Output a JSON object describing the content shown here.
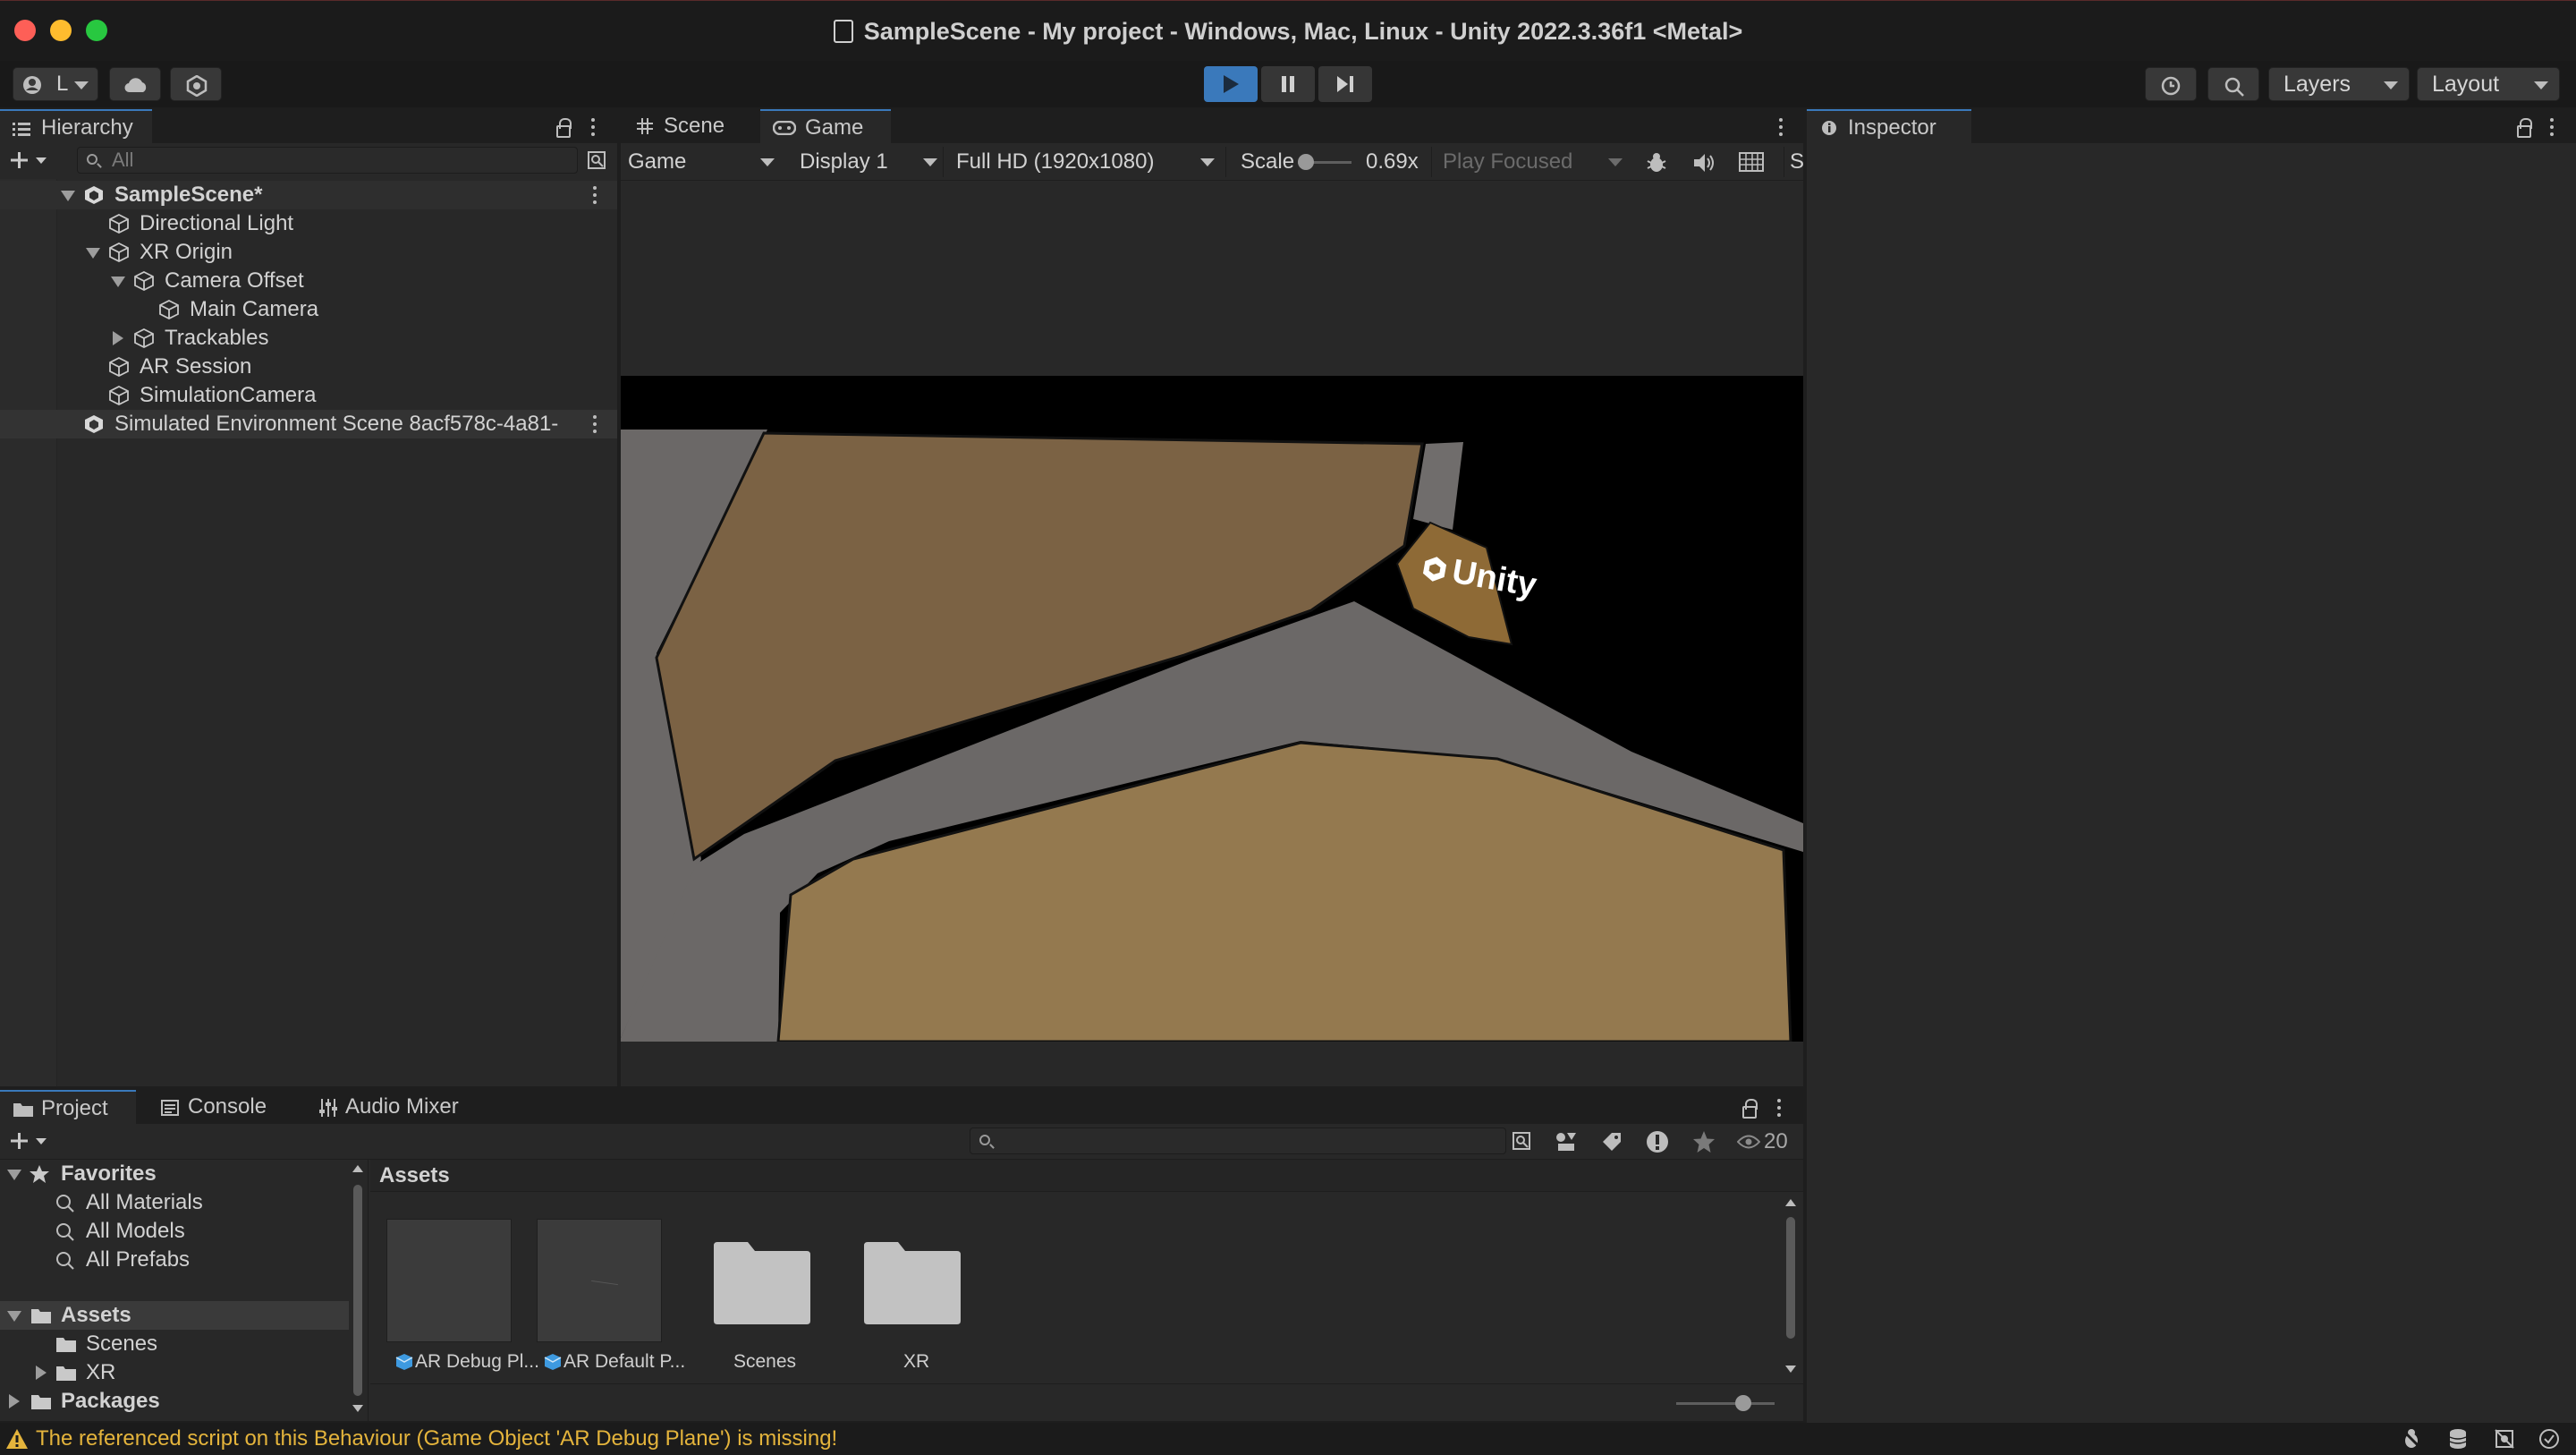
{
  "window": {
    "title": "SampleScene - My project - Windows, Mac, Linux - Unity 2022.3.36f1 <Metal>"
  },
  "toolbar": {
    "account_label": "L",
    "layers_label": "Layers",
    "layout_label": "Layout"
  },
  "hierarchy": {
    "tab_label": "Hierarchy",
    "search_placeholder": "All",
    "items": [
      {
        "label": "SampleScene*"
      },
      {
        "label": "Directional Light"
      },
      {
        "label": "XR Origin"
      },
      {
        "label": "Camera Offset"
      },
      {
        "label": "Main Camera"
      },
      {
        "label": "Trackables"
      },
      {
        "label": "AR Session"
      },
      {
        "label": "SimulationCamera"
      },
      {
        "label": "Simulated Environment Scene 8acf578c-4a81-"
      }
    ]
  },
  "center": {
    "tabs": [
      {
        "label": "Scene"
      },
      {
        "label": "Game"
      }
    ],
    "game_toolbar": {
      "mode": "Game",
      "display": "Display 1",
      "resolution": "Full HD (1920x1080)",
      "scale_label": "Scale",
      "scale_value": "0.69x",
      "play_focused": "Play Focused",
      "trailing": "S"
    },
    "viewport_logo": "Unity"
  },
  "inspector": {
    "tab_label": "Inspector"
  },
  "bottom": {
    "tabs": [
      {
        "label": "Project"
      },
      {
        "label": "Console"
      },
      {
        "label": "Audio Mixer"
      }
    ],
    "hidden_count": "20",
    "tree": {
      "favorites": "Favorites",
      "fav_items": [
        "All Materials",
        "All Models",
        "All Prefabs"
      ],
      "assets": "Assets",
      "asset_items": [
        "Scenes",
        "XR"
      ],
      "packages": "Packages"
    },
    "breadcrumb": "Assets",
    "grid_items": [
      {
        "label": "AR Debug Pl..."
      },
      {
        "label": "AR Default P..."
      },
      {
        "label": "Scenes"
      },
      {
        "label": "XR"
      }
    ]
  },
  "status": {
    "message": "The referenced script on this Behaviour (Game Object 'AR Debug Plane') is missing!"
  },
  "colors": {
    "accent": "#3a79bb",
    "warning": "#e4b43c",
    "panel": "#282828",
    "plane": "#8c6d45"
  }
}
